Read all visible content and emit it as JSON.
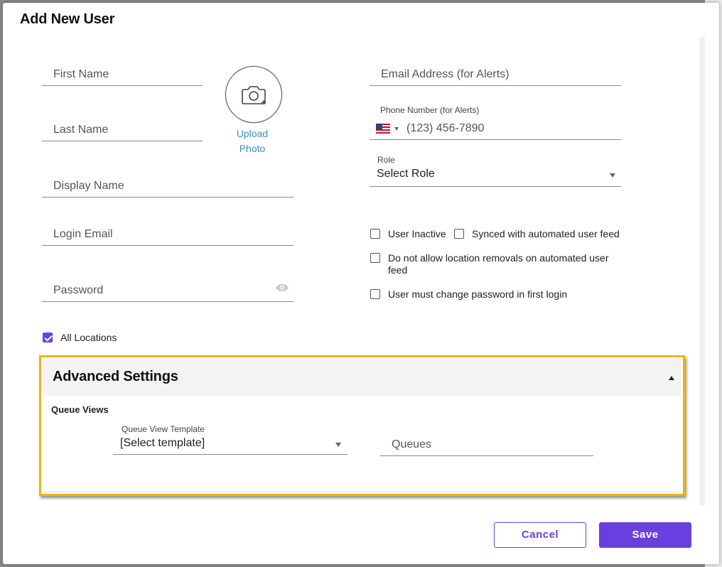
{
  "dialog": {
    "title": "Add New User"
  },
  "form": {
    "first_name_placeholder": "First Name",
    "last_name_placeholder": "Last Name",
    "display_name_placeholder": "Display Name",
    "login_email_placeholder": "Login Email",
    "password_placeholder": "Password",
    "email_alerts_placeholder": "Email Address (for Alerts)",
    "phone_label": "Phone Number (for Alerts)",
    "phone_placeholder": "(123) 456-7890",
    "role_label": "Role",
    "role_value": "Select Role"
  },
  "photo": {
    "upload_label_line1": "Upload",
    "upload_label_line2": "Photo"
  },
  "checkboxes": {
    "user_inactive": {
      "label": "User Inactive",
      "checked": false
    },
    "synced_feed": {
      "label": "Synced with automated user feed",
      "checked": false
    },
    "no_location_removal": {
      "label": "Do not allow location removals on automated user feed",
      "checked": false
    },
    "must_change_password": {
      "label": "User must change password in first login",
      "checked": false
    },
    "all_locations": {
      "label": "All Locations",
      "checked": true
    }
  },
  "advanced": {
    "title": "Advanced Settings",
    "section_label": "Queue Views",
    "template_label": "Queue View Template",
    "template_value": "[Select template]",
    "queues_placeholder": "Queues"
  },
  "footer": {
    "cancel_label": "Cancel",
    "save_label": "Save"
  },
  "colors": {
    "accent": "#6a3fe0",
    "highlight_border": "#f0b400",
    "link": "#3b8ec2"
  }
}
